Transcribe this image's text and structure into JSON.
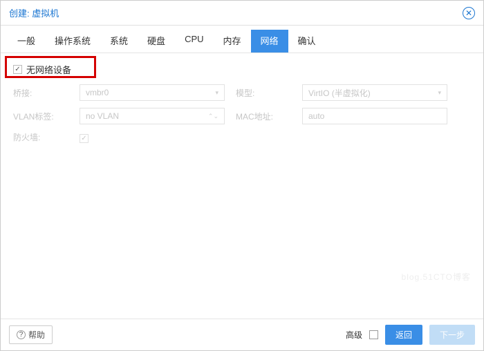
{
  "window": {
    "title": "创建: 虚拟机"
  },
  "tabs": [
    {
      "label": "一般"
    },
    {
      "label": "操作系统"
    },
    {
      "label": "系统"
    },
    {
      "label": "硬盘"
    },
    {
      "label": "CPU"
    },
    {
      "label": "内存"
    },
    {
      "label": "网络",
      "active": true
    },
    {
      "label": "确认"
    }
  ],
  "form": {
    "no_network_label": "无网络设备",
    "no_network_checked": true,
    "bridge": {
      "label": "桥接:",
      "value": "vmbr0"
    },
    "vlan": {
      "label": "VLAN标签:",
      "value": "no VLAN"
    },
    "firewall": {
      "label": "防火墙:",
      "checked": true
    },
    "model": {
      "label": "模型:",
      "value": "VirtIO (半虚拟化)"
    },
    "mac": {
      "label": "MAC地址:",
      "value": "auto"
    }
  },
  "footer": {
    "help": "帮助",
    "advanced": "高级",
    "back": "返回",
    "next": "下一步"
  },
  "watermark": "blog.51CTO博客"
}
